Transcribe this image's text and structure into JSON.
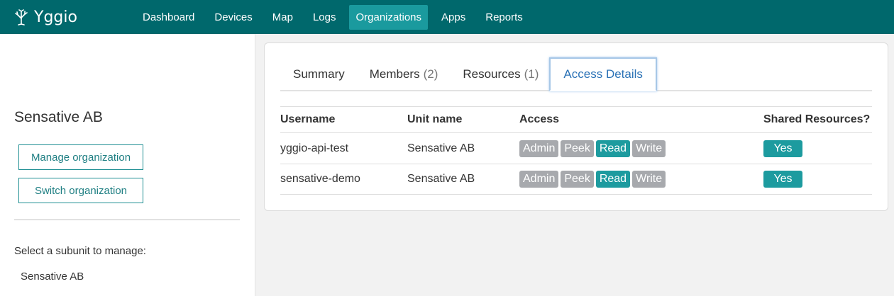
{
  "app": {
    "name": "Yggio"
  },
  "nav": [
    {
      "label": "Dashboard",
      "active": false
    },
    {
      "label": "Devices",
      "active": false
    },
    {
      "label": "Map",
      "active": false
    },
    {
      "label": "Logs",
      "active": false
    },
    {
      "label": "Organizations",
      "active": true
    },
    {
      "label": "Apps",
      "active": false
    },
    {
      "label": "Reports",
      "active": false
    }
  ],
  "sidebar": {
    "org_name": "Sensative AB",
    "manage_label": "Manage organization",
    "switch_label": "Switch organization",
    "subunit_prompt": "Select a subunit to manage:",
    "subunits": [
      "Sensative AB"
    ]
  },
  "tabs": [
    {
      "label": "Summary",
      "count": ""
    },
    {
      "label": "Members",
      "count": "(2)"
    },
    {
      "label": "Resources",
      "count": "(1)"
    },
    {
      "label": "Access Details",
      "count": "",
      "active": true
    }
  ],
  "table": {
    "headers": [
      "Username",
      "Unit name",
      "Access",
      "Shared Resources?"
    ],
    "access_levels": [
      "Admin",
      "Peek",
      "Read",
      "Write"
    ],
    "rows": [
      {
        "username": "yggio-api-test",
        "unit": "Sensative AB",
        "active_access": "Read",
        "shared": "Yes"
      },
      {
        "username": "sensative-demo",
        "unit": "Sensative AB",
        "active_access": "Read",
        "shared": "Yes"
      }
    ]
  },
  "colors": {
    "topbar": "#00686c",
    "accent": "#1d9b9f",
    "inactive_pill": "#a7a9ad",
    "active_tab_text": "#2b72b6"
  }
}
